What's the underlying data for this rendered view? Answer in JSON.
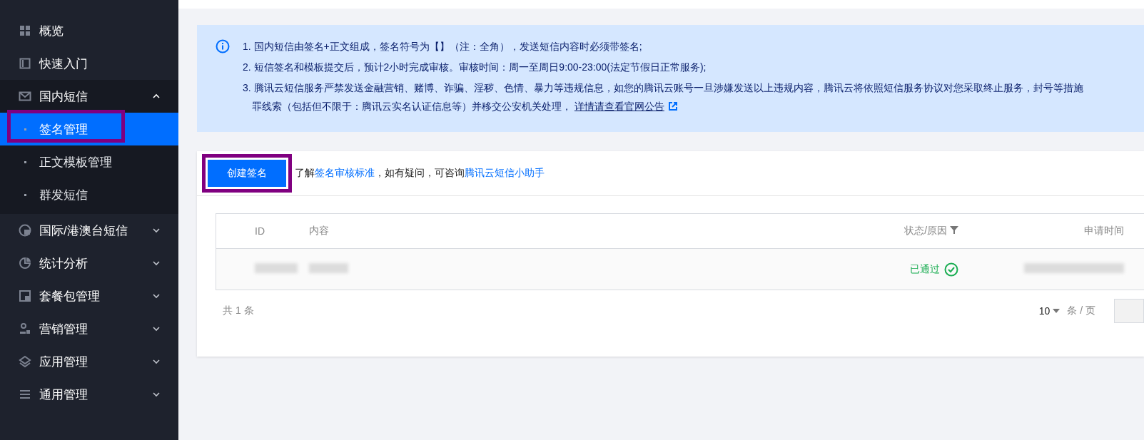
{
  "sidebar": {
    "items": [
      {
        "label": "概览"
      },
      {
        "label": "快速入门"
      },
      {
        "label": "国内短信",
        "expanded": true,
        "children": [
          {
            "label": "签名管理",
            "selected": true,
            "highlighted": true
          },
          {
            "label": "正文模板管理",
            "selected": false,
            "highlighted": false
          },
          {
            "label": "群发短信",
            "selected": false,
            "highlighted": false
          }
        ]
      },
      {
        "label": "国际/港澳台短信",
        "expanded": false
      },
      {
        "label": "统计分析",
        "expanded": false
      },
      {
        "label": "套餐包管理",
        "expanded": false
      },
      {
        "label": "营销管理",
        "expanded": false
      },
      {
        "label": "应用管理",
        "expanded": false
      },
      {
        "label": "通用管理",
        "expanded": false
      }
    ]
  },
  "notice": {
    "lines": [
      "1. 国内短信由签名+正文组成，签名符号为【】（注：全角），发送短信内容时必须带签名;",
      "2. 短信签名和模板提交后，预计2小时完成审核。审核时间：周一至周日9:00-23:00(法定节假日正常服务);",
      "3. 腾讯云短信服务严禁发送金融营销、赌博、诈骗、淫秽、色情、暴力等违规信息，如您的腾讯云账号一旦涉嫌发送以上违规内容，腾讯云将依照短信服务协议对您采取终止服务，封号等措施",
      "罪线索（包括但不限于：腾讯云实名认证信息等）并移交公安机关处理，"
    ],
    "link": "详情请查看官网公告"
  },
  "toolbar": {
    "button": {
      "label": "创建签名",
      "highlighted": true
    },
    "hint": [
      {
        "kind": "text",
        "text": "了解"
      },
      {
        "kind": "link",
        "text": "签名审核标准"
      },
      {
        "kind": "text",
        "text": "，如有疑问，可咨询"
      },
      {
        "kind": "link",
        "text": "腾讯云短信小助手"
      }
    ]
  },
  "table": {
    "columns": [
      "ID",
      "内容",
      "状态/原因",
      "申请时间"
    ],
    "rows": [
      {
        "status": "已通过",
        "approved": true
      }
    ]
  },
  "footer": {
    "total": "共 1 条",
    "page_size": "10",
    "per_page": "条 / 页"
  }
}
